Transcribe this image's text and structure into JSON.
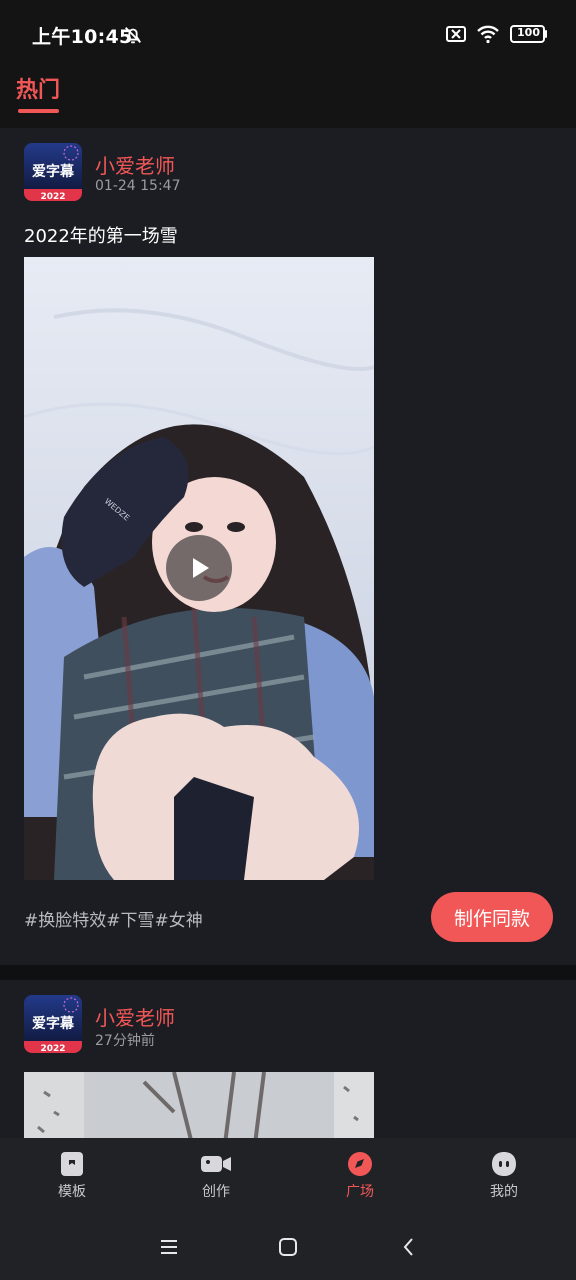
{
  "status_bar": {
    "time": "上午10:45",
    "battery": "100",
    "icons": [
      "bell-off-icon",
      "sim-off-icon",
      "wifi-icon",
      "battery-icon"
    ]
  },
  "header": {
    "tab_active": "热门",
    "accent": "#f25757"
  },
  "feed": {
    "posts": [
      {
        "avatar_title": "爱字幕",
        "avatar_year": "2022",
        "author": "小爱老师",
        "time": "01-24 15:47",
        "caption": "2022年的第一场雪",
        "tags": "#换脸特效#下雪#女神",
        "cta": "制作同款"
      },
      {
        "avatar_title": "爱字幕",
        "avatar_year": "2022",
        "author": "小爱老师",
        "time": "27分钟前"
      }
    ]
  },
  "tabbar": {
    "items": [
      {
        "label": "模板",
        "icon": "template-icon",
        "active": false
      },
      {
        "label": "创作",
        "icon": "camera-icon",
        "active": false
      },
      {
        "label": "广场",
        "icon": "compass-icon",
        "active": true
      },
      {
        "label": "我的",
        "icon": "profile-icon",
        "active": false
      }
    ]
  },
  "navbar": {
    "icons": [
      "menu-icon",
      "home-icon",
      "back-icon"
    ]
  }
}
